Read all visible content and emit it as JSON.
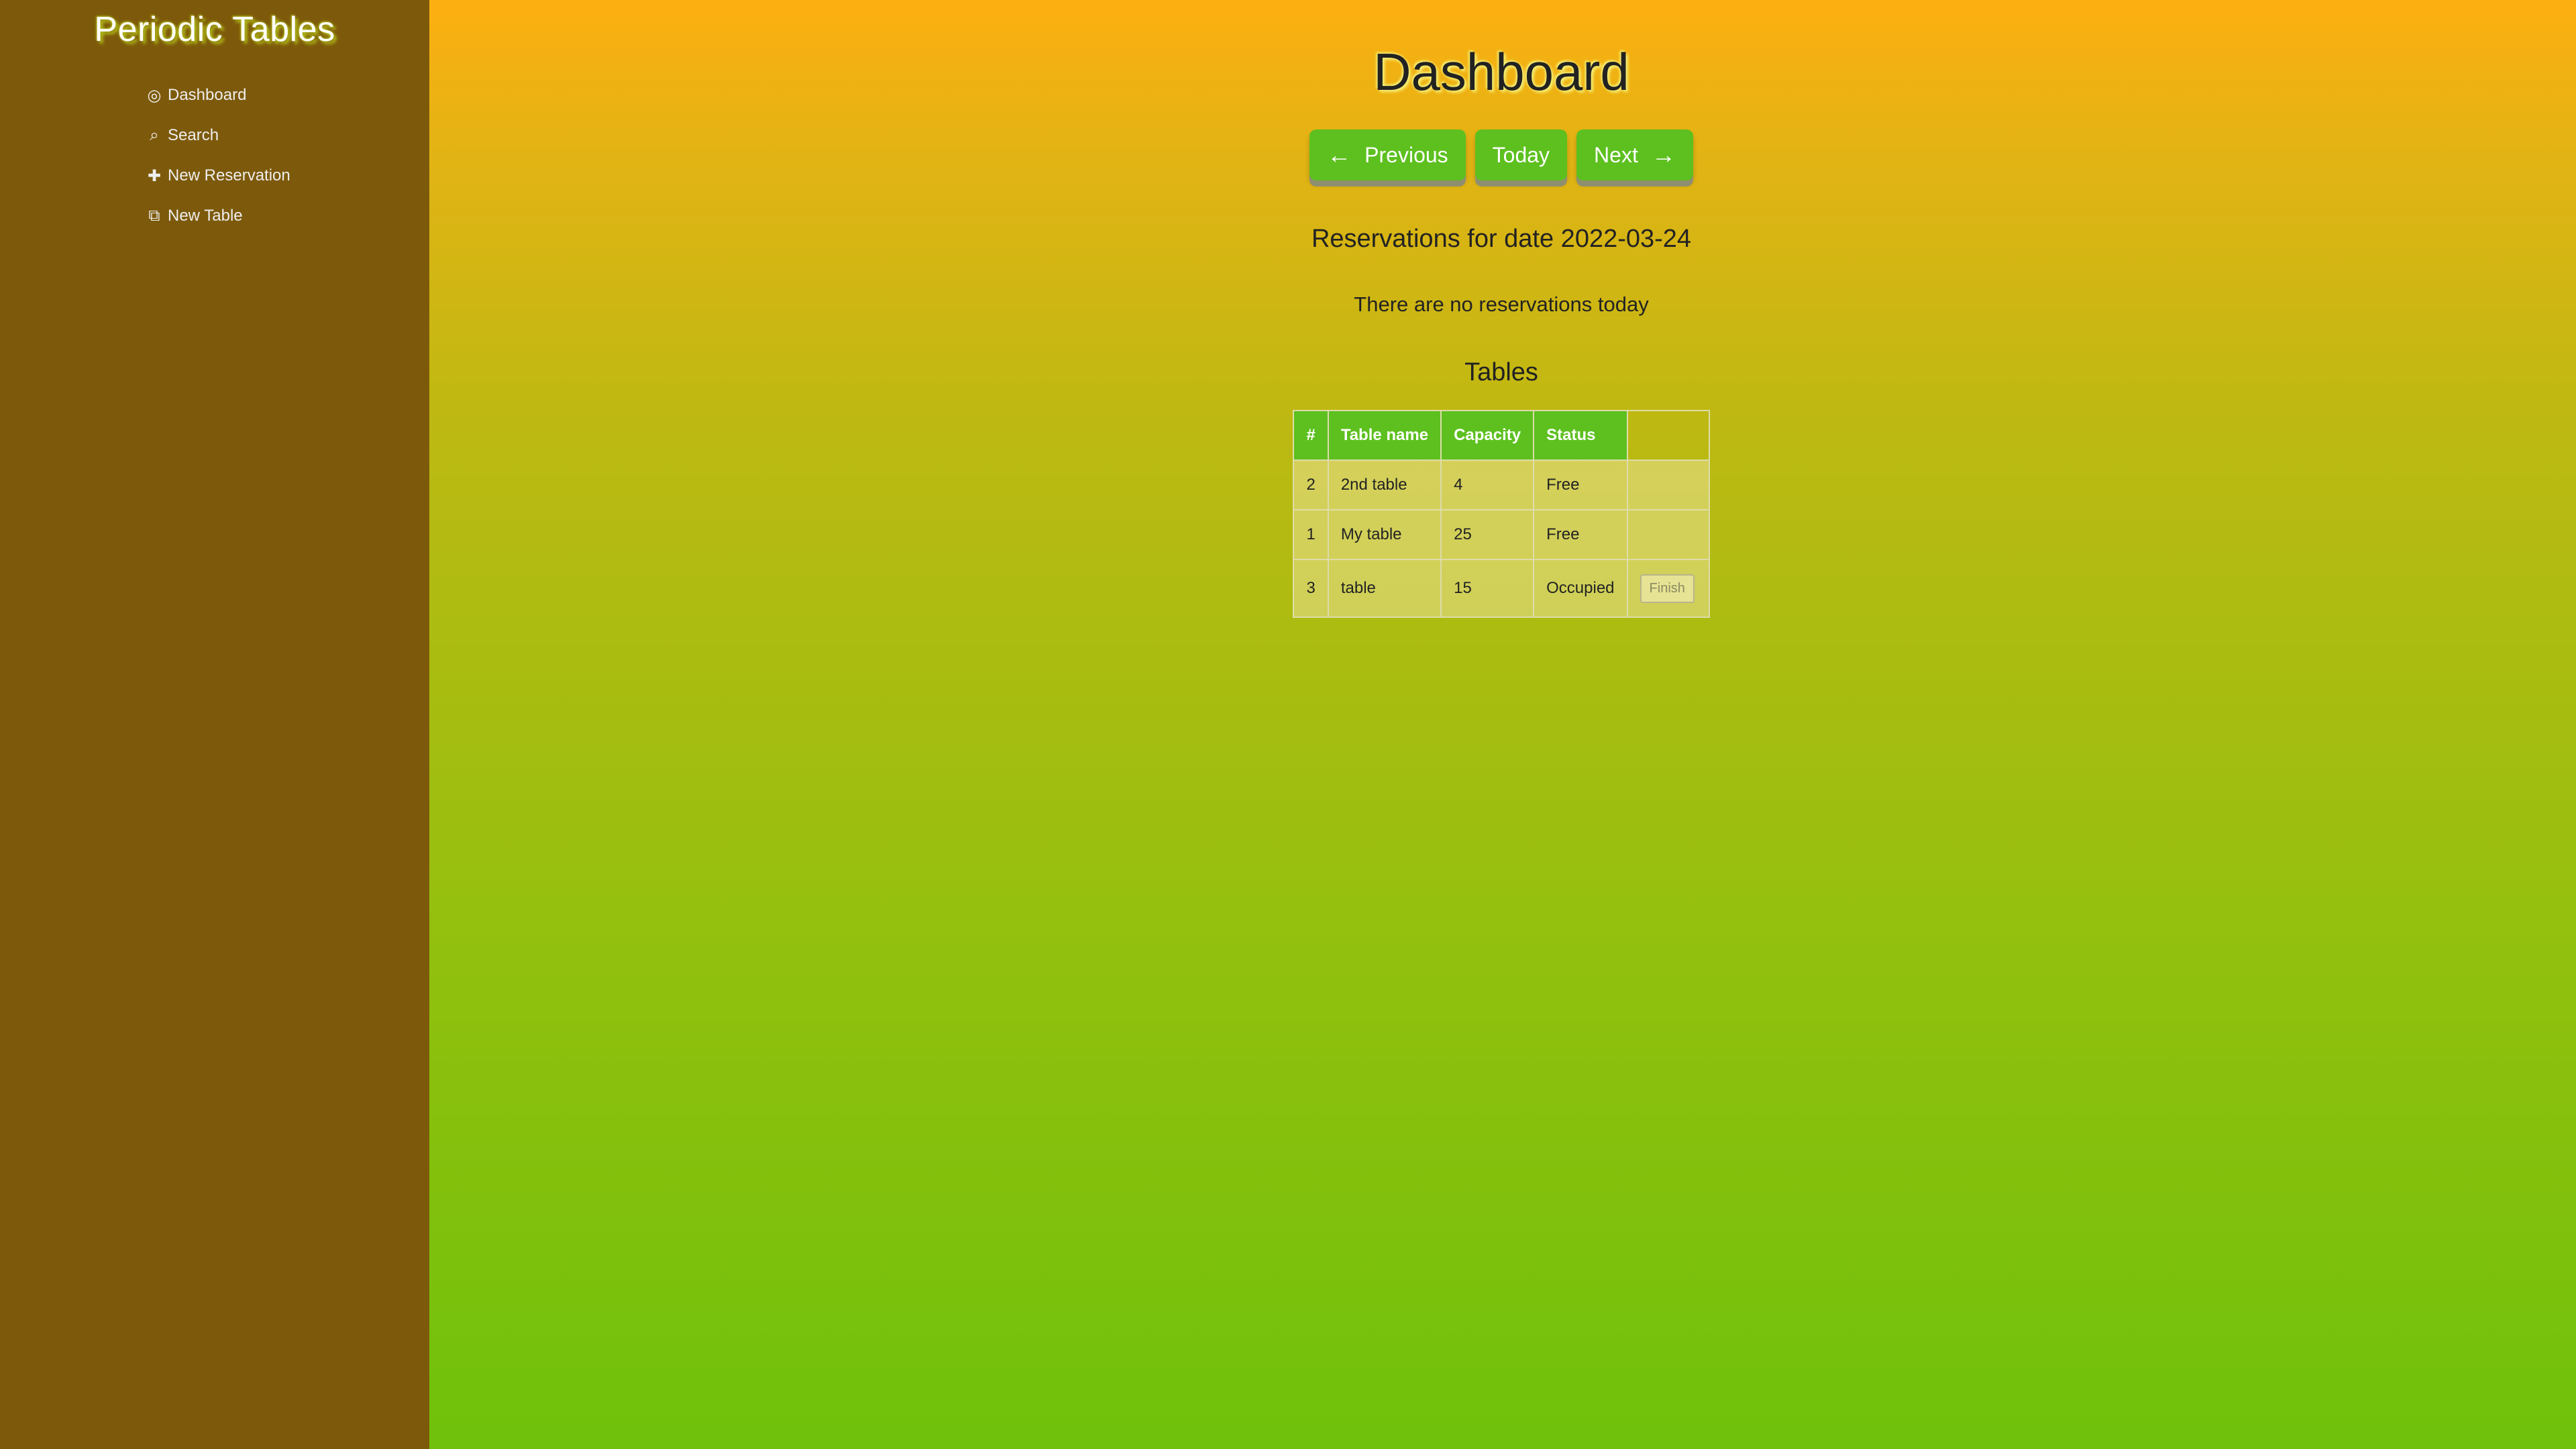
{
  "sidebar": {
    "brand": "Periodic Tables",
    "items": [
      {
        "label": "Dashboard",
        "icon": "dashboard-icon",
        "glyph": "◎"
      },
      {
        "label": "Search",
        "icon": "search-icon",
        "glyph": "⌕"
      },
      {
        "label": "New Reservation",
        "icon": "plus-icon",
        "glyph": "✚"
      },
      {
        "label": "New Table",
        "icon": "new-table-icon",
        "glyph": "⧉"
      }
    ]
  },
  "main": {
    "title": "Dashboard",
    "buttons": {
      "previous": "Previous",
      "today": "Today",
      "next": "Next"
    },
    "reservations_heading": "Reservations for date 2022-03-24",
    "no_reservations": "There are no reservations today",
    "tables_heading": "Tables",
    "table": {
      "headers": [
        "#",
        "Table name",
        "Capacity",
        "Status",
        ""
      ],
      "rows": [
        {
          "id": "2",
          "name": "2nd table",
          "capacity": "4",
          "status": "Free",
          "action": ""
        },
        {
          "id": "1",
          "name": "My table",
          "capacity": "25",
          "status": "Free",
          "action": ""
        },
        {
          "id": "3",
          "name": "table",
          "capacity": "15",
          "status": "Occupied",
          "action": "Finish"
        }
      ]
    }
  },
  "colors": {
    "sidebar_bg": "#7d5a0b",
    "accent_green": "#5dc01f",
    "gradient_top": "#fdaf10",
    "gradient_bottom": "#6fc10b"
  }
}
